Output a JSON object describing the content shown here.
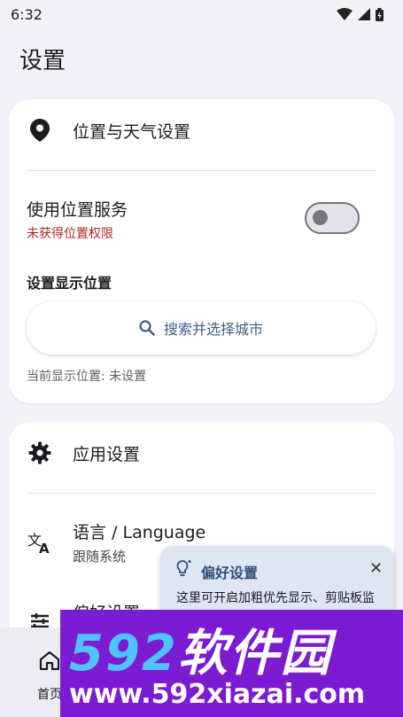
{
  "status": {
    "time": "6:32"
  },
  "page": {
    "title": "设置"
  },
  "location_section": {
    "header": "位置与天气设置",
    "use_location": {
      "title": "使用位置服务",
      "subtitle": "未获得位置权限"
    },
    "display_location_title": "设置显示位置",
    "search_button": "搜索并选择城市",
    "current_location": "当前显示位置: 未设置"
  },
  "app_section": {
    "header": "应用设置",
    "language": {
      "title": "语言 / Language",
      "subtitle": "跟随系统"
    },
    "preferences": {
      "title": "偏好设置"
    }
  },
  "tooltip": {
    "title": "偏好设置",
    "body": "这里可开启加粗优先显示、剪贴板监控等个性化设置"
  },
  "bottom_nav": {
    "home_label": "首页"
  },
  "watermark": {
    "brand_num": "592",
    "brand_text": "软件园",
    "url": "www.592xiazai.com"
  },
  "colors": {
    "error": "#b3261e",
    "accent": "#3f5f86",
    "watermark_bg": "#7b1bd2"
  }
}
